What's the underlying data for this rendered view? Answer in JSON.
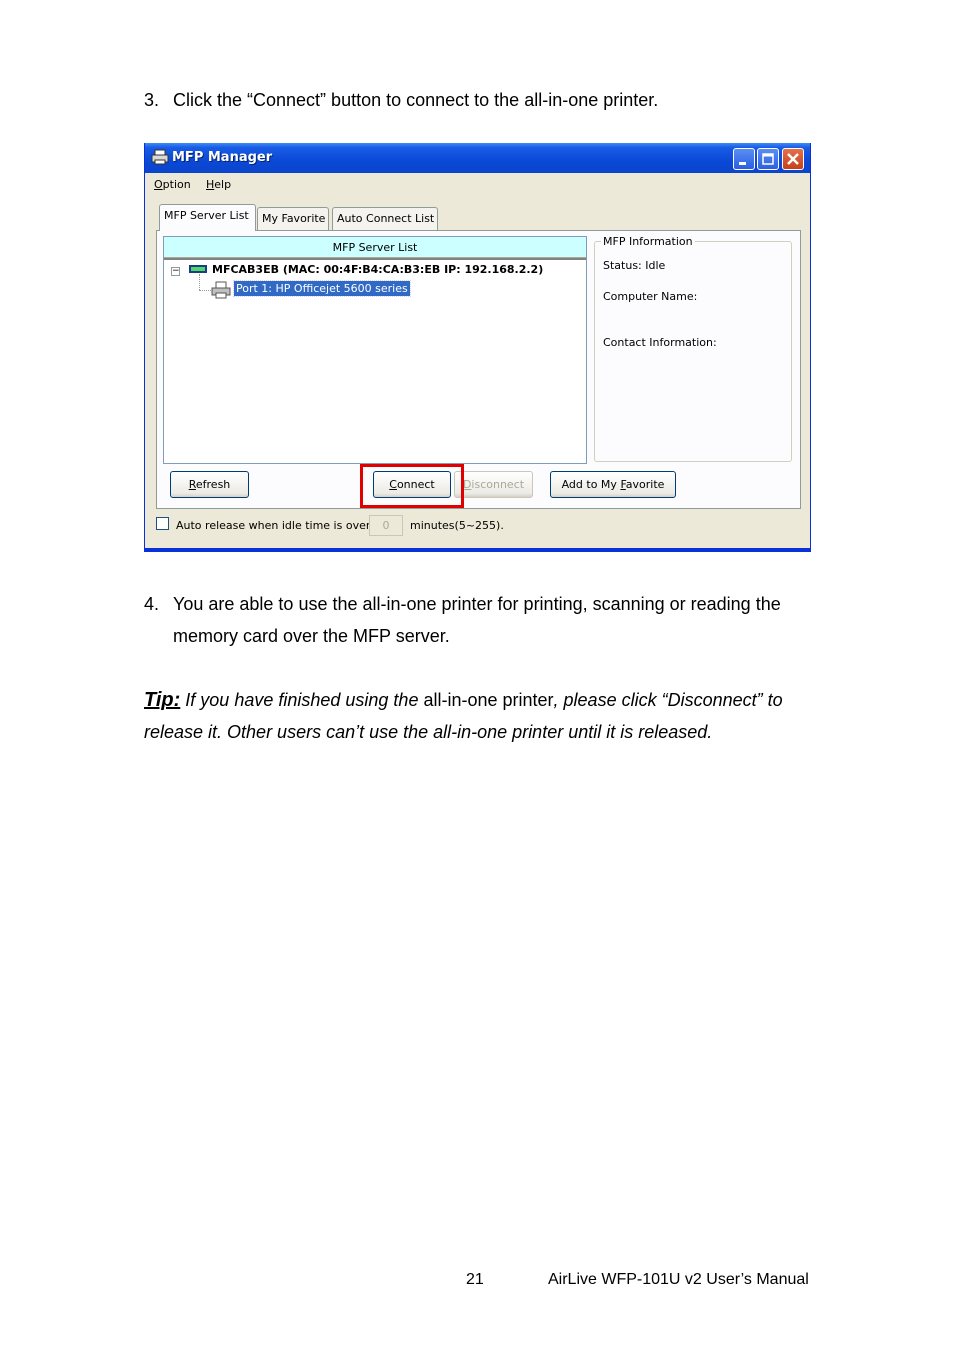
{
  "step3": {
    "num": "3.",
    "text": "Click the “Connect” button to connect to the all-in-one printer."
  },
  "window": {
    "title": "MFP Manager",
    "menu": {
      "option_label": "ption",
      "option_mnemonic": "O",
      "help_label": "elp",
      "help_mnemonic": "H"
    },
    "tabs": [
      "MFP Server List",
      "My Favorite",
      "Auto Connect List"
    ],
    "server_list": {
      "header": "MFP Server List",
      "server": "MFCAB3EB (MAC: 00:4F:B4:CA:B3:EB   IP: 192.168.2.2)",
      "port": "Port 1: HP Officejet 5600 series"
    },
    "info": {
      "legend": "MFP Information",
      "status": "Status: Idle",
      "computer_name": "Computer Name:",
      "contact": "Contact Information:"
    },
    "buttons": {
      "refresh_m": "R",
      "refresh": "efresh",
      "connect_m": "C",
      "connect": "onnect",
      "disconnect_m": "D",
      "disconnect": "isconnect",
      "favorite_pre": "Add to My ",
      "favorite_m": "F",
      "favorite": "avorite"
    },
    "auto_release": {
      "label": "Auto release when idle time is over",
      "value": "0",
      "suffix": "minutes(5~255)."
    }
  },
  "step4": {
    "num": "4.",
    "text": "You are able to use the all-in-one printer for printing, scanning or reading the memory card over the MFP server."
  },
  "tip": {
    "label": "Tip:",
    "part1": " If you have finished using the ",
    "part2": "all-in-one printer",
    "part3": ", please click “Disconnect” to release it. Other users can’t use the all-in-one printer until it is released."
  },
  "footer": {
    "page": "21",
    "manual": "AirLive WFP-101U v2 User’s Manual"
  },
  "colors": {
    "titlebar": "#0a49d6",
    "highlight": "#e00000",
    "selection": "#316ac5",
    "list_header": "#ccffff"
  }
}
